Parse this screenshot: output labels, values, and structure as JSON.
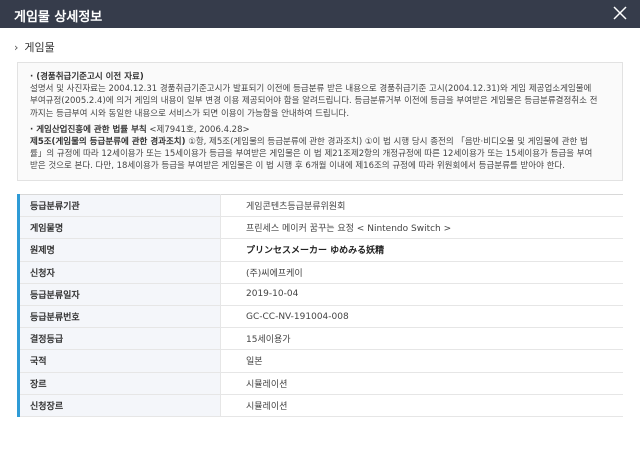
{
  "header": {
    "title": "게임물 상세정보",
    "close_icon": "close-icon"
  },
  "section": {
    "chevron": "›",
    "title": "게임물"
  },
  "notice": {
    "p1_heading": "· (경품취급기준고시 이전 자료)",
    "p1_line1": "설명서 및 사진자료는 2004.12.31 경품취급기준고시가 발표되기 이전에 등급분류 받은 내용으로 경품취급기준 고시(2004.12.31)와 게임 제공업소게임물에",
    "p1_line2": "부여규정(2005.2.4)에 의거 게임의 내용이 일부 변경 이용 제공되어야 함을 알려드립니다. 등급분류거부 이전에 등급을 부여받은 게임물은 등급분류결정취소 전",
    "p1_line3": "까지는 등급부여 시와 동일한 내용으로 서비스가 되면 이용이 가능함을 안내하여 드립니다.",
    "p2_heading_bold": "· 게임산업진흥에 관한 법률 부칙",
    "p2_heading_rest": " <제7941호, 2006.4.28>",
    "p2_line1_bold": "제5조(게임물의 등급분류에 관한 경과조치)",
    "p2_line1_rest": " ①항, 제5조(게임물의 등급분류에 관한 경과조치) ①이 법 시행 당시 종전의 「음반·비디오물 및 게임물에 관한 법",
    "p2_line2": "률」의 규정에 따라 12세이용가 또는 15세이용가 등급을 부여받은 게임물은 이 법 제21조제2항의 개정규정에 따른 12세이용가 또는 15세이용가 등급을 부여",
    "p2_line3": "받은 것으로 본다. 다만, 18세이용가 등급을 부여받은 게임물은 이 법 시행 후 6개월 이내에 제16조의 규정에 따라 위원회에서 등급분류를 받아야 한다."
  },
  "info_rows": [
    {
      "label": "등급분류기관",
      "value": "게임콘텐츠등급분류위원회"
    },
    {
      "label": "게임물명",
      "value": "프린세스 메이커 꿈꾸는 요정 < Nintendo Switch >"
    },
    {
      "label": "원제명",
      "value": "プリンセスメーカー ゆめみる妖精"
    },
    {
      "label": "신청자",
      "value": "(주)씨에프케이"
    },
    {
      "label": "등급분류일자",
      "value": "2019-10-04"
    },
    {
      "label": "등급분류번호",
      "value": "GC-CC-NV-191004-008"
    },
    {
      "label": "결정등급",
      "value": "15세이용가"
    },
    {
      "label": "국적",
      "value": "일본"
    },
    {
      "label": "장르",
      "value": "시뮬레이션"
    },
    {
      "label": "신청장르",
      "value": "시뮬레이션"
    }
  ]
}
